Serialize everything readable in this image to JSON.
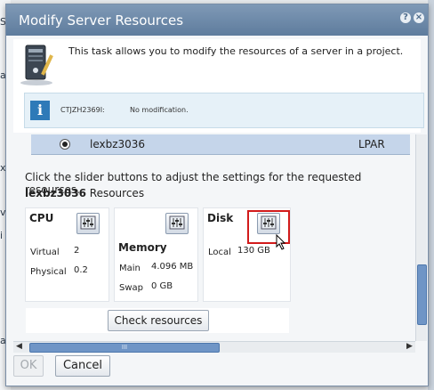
{
  "background": {
    "left_fragments": [
      "S",
      "a",
      "xl",
      "vi",
      "i",
      "a"
    ]
  },
  "dialog": {
    "title": "Modify Server Resources",
    "help_icon": "?",
    "close_icon": "×",
    "intro": "This task allows you to modify the resources of a server in a project.",
    "message": {
      "id": "CTJZH2369I:",
      "text": "No modification."
    },
    "server_row": {
      "name": "lexbz3036",
      "type": "LPAR"
    },
    "instructions": "Click the slider buttons to adjust the settings for the requested resources.",
    "resources_heading": {
      "server": "lexbz3036",
      "suffix": " Resources"
    },
    "cpu": {
      "title": "CPU",
      "virtual_label": "Virtual",
      "virtual_value": "2",
      "physical_label": "Physical",
      "physical_value": "0.2"
    },
    "memory": {
      "title": "Memory",
      "main_label": "Main",
      "main_value": "4.096 MB",
      "swap_label": "Swap",
      "swap_value": "0 GB"
    },
    "disk": {
      "title": "Disk",
      "local_label": "Local",
      "local_value": "130 GB"
    },
    "check_resources": "Check resources",
    "scroll_grip": "III",
    "scroll_left": "◀",
    "scroll_right": "▶",
    "ok": "OK",
    "cancel": "Cancel"
  },
  "icons": {
    "info": "i",
    "slider": "slider-icon"
  },
  "colors": {
    "title_bar": "#6f8cad",
    "selected_row": "#c5d5ea",
    "highlight": "#d21b1b",
    "info_icon": "#2e7ab8"
  }
}
